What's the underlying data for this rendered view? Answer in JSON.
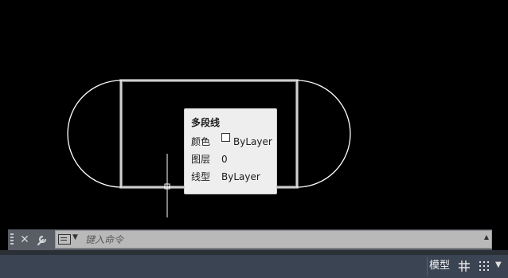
{
  "tooltip": {
    "title": "多段线",
    "rows": [
      {
        "key": "颜色",
        "value": "ByLayer",
        "swatch": true
      },
      {
        "key": "图层",
        "value": "0",
        "swatch": false
      },
      {
        "key": "线型",
        "value": "ByLayer",
        "swatch": false
      }
    ]
  },
  "command_line": {
    "placeholder": "键入命令",
    "close_icon": "close-icon",
    "customize_icon": "wrench-icon",
    "prompt_icon": "command-prompt-icon"
  },
  "status_bar": {
    "model_label": "模型",
    "grid_icon": "grid-icon",
    "snap_icon": "snap-mode-icon"
  },
  "colors": {
    "canvas_bg": "#000000",
    "geometry": "#ffffff",
    "tooltip_bg": "#eeeeee",
    "command_input_bg": "#b9b9b9",
    "status_bar_bg": "#3b4453"
  }
}
